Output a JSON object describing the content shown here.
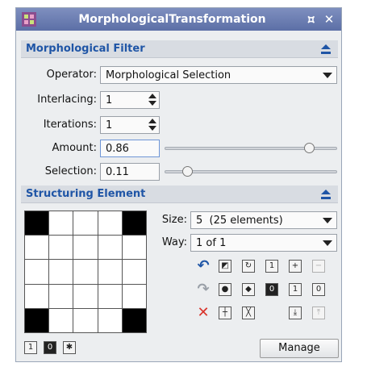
{
  "window": {
    "title": "MorphologicalTransformation",
    "icons": {
      "app": "morphology-app-icon",
      "shade": "shade-icon",
      "close": "close-icon"
    }
  },
  "filter_section": {
    "title": "Morphological Filter",
    "operator": {
      "label": "Operator:",
      "value": "Morphological Selection"
    },
    "interlacing": {
      "label": "Interlacing:",
      "value": "1"
    },
    "iterations": {
      "label": "Iterations:",
      "value": "1"
    },
    "amount": {
      "label": "Amount:",
      "value": "0.86",
      "level": 0.86
    },
    "selection": {
      "label": "Selection:",
      "value": "0.11",
      "level": 0.11
    }
  },
  "structuring_section": {
    "title": "Structuring Element",
    "size": {
      "label": "Size:",
      "value": "5  (25 elements)"
    },
    "way": {
      "label": "Way:",
      "value": "1 of 1"
    },
    "grid": [
      [
        1,
        0,
        0,
        0,
        1
      ],
      [
        0,
        0,
        0,
        0,
        0
      ],
      [
        0,
        0,
        0,
        0,
        0
      ],
      [
        0,
        0,
        0,
        0,
        0
      ],
      [
        1,
        0,
        0,
        0,
        1
      ]
    ],
    "bottom_buttons": [
      {
        "name": "set-ones-button",
        "glyph": "1"
      },
      {
        "name": "set-zeros-button",
        "glyph": "0"
      },
      {
        "name": "toggle-elements-button",
        "glyph": "✱"
      }
    ],
    "tool_buttons": {
      "row1": [
        {
          "name": "undo-button",
          "glyph": "↶",
          "style": "undo"
        },
        {
          "name": "invert-button",
          "glyph": "◩",
          "style": "plain"
        },
        {
          "name": "rotate-button",
          "glyph": "↻",
          "style": "plain"
        },
        {
          "name": "set-one-button",
          "glyph": "1",
          "style": "plain"
        },
        {
          "name": "add-way-button",
          "glyph": "+",
          "style": "plain"
        },
        {
          "name": "remove-way-button",
          "glyph": "−",
          "style": "disabled"
        }
      ],
      "row2": [
        {
          "name": "redo-button",
          "glyph": "↷",
          "style": "redo"
        },
        {
          "name": "circle-button",
          "glyph": "●",
          "style": "plain"
        },
        {
          "name": "diamond-button",
          "glyph": "◆",
          "style": "plain"
        },
        {
          "name": "set-zero-button",
          "glyph": "0",
          "style": "dark"
        },
        {
          "name": "one-all-button",
          "glyph": "1",
          "style": "plain"
        },
        {
          "name": "zero-all-button",
          "glyph": "0",
          "style": "plain"
        }
      ],
      "row3": [
        {
          "name": "delete-button",
          "glyph": "✕",
          "style": "delete"
        },
        {
          "name": "orthogonal-button",
          "glyph": "┼",
          "style": "plain"
        },
        {
          "name": "diagonal-button",
          "glyph": "╳",
          "style": "plain"
        },
        {
          "name": "move-down-button",
          "glyph": "⤓",
          "style": "plain"
        },
        {
          "name": "move-up-button",
          "glyph": "⤒",
          "style": "disabled"
        }
      ]
    },
    "manage_label": "Manage"
  }
}
